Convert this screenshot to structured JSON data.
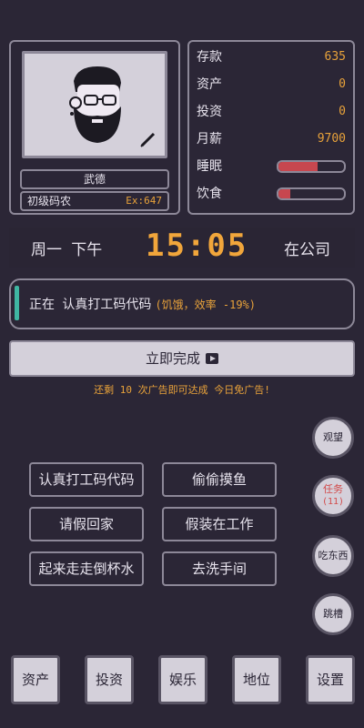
{
  "profile": {
    "name": "武德",
    "rank": "初级码农",
    "exp": "Ex:647"
  },
  "stats": {
    "savings_label": "存款",
    "savings_value": "635",
    "assets_label": "资产",
    "assets_value": "0",
    "invest_label": "投资",
    "invest_value": "0",
    "salary_label": "月薪",
    "salary_value": "9700",
    "sleep_label": "睡眠",
    "sleep_level": 0.6,
    "food_label": "饮食",
    "food_level": 0.18,
    "bar_color": "#c7474f"
  },
  "clock": {
    "day": "周一 下午",
    "time": "15:05",
    "location": "在公司"
  },
  "status": {
    "prefix": "正在 认真打工码代码",
    "warning": "(饥饿，效率 -19%)"
  },
  "complete_button": {
    "label": "立即完成",
    "icon": "play-icon"
  },
  "ad_note": "还剩 10 次广告即可达成 今日免广告!",
  "round_buttons": {
    "watch": "观望",
    "task": "任务",
    "task_count": "(11)",
    "eat": "吃东西",
    "quit": "跳槽"
  },
  "actions": [
    "认真打工码代码",
    "偷偷摸鱼",
    "请假回家",
    "假装在工作",
    "起来走走倒杯水",
    "去洗手间"
  ],
  "nav": [
    "资产",
    "投资",
    "娱乐",
    "地位",
    "设置"
  ],
  "colors": {
    "accent": "#f1a63b",
    "panel_bg": "#2b2636",
    "status_accent": "#3fb6a2"
  }
}
